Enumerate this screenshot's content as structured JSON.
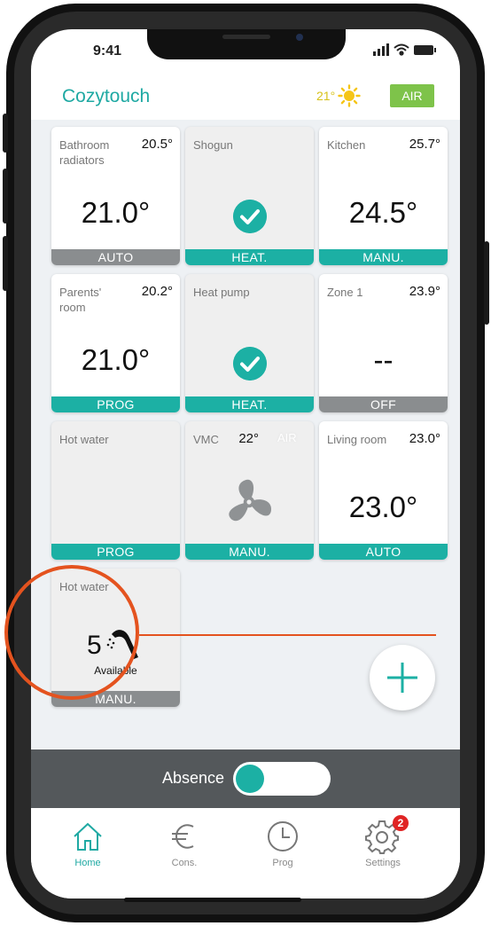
{
  "status_bar": {
    "time": "9:41"
  },
  "header": {
    "title": "Cozytouch",
    "outdoor_temp": "21°",
    "air_label": "AIR"
  },
  "tiles": [
    {
      "name": "Bathroom radiators",
      "temp": "20.5°",
      "setpoint": "21.0°",
      "mode": "AUTO"
    },
    {
      "name": "Shogun",
      "temp": "",
      "setpoint": "",
      "mode": "HEAT."
    },
    {
      "name": "Kitchen",
      "temp": "25.7°",
      "setpoint": "24.5°",
      "mode": "MANU."
    },
    {
      "name": "Parents' room",
      "temp": "20.2°",
      "setpoint": "21.0°",
      "mode": "PROG"
    },
    {
      "name": "Heat pump",
      "temp": "",
      "setpoint": "",
      "mode": "HEAT."
    },
    {
      "name": "Zone 1",
      "temp": "23.9°",
      "setpoint": "--",
      "mode": "OFF"
    },
    {
      "name": "Hot water",
      "temp": "",
      "setpoint": "",
      "mode": "PROG"
    },
    {
      "name": "VMC",
      "temp": "22°",
      "extra": "AIR",
      "setpoint": "",
      "mode": "MANU."
    },
    {
      "name": "Living room",
      "temp": "23.0°",
      "setpoint": "23.0°",
      "mode": "AUTO"
    },
    {
      "name": "Hot water",
      "temp": "",
      "showers": "5",
      "available_label": "Available",
      "mode": "MANU."
    }
  ],
  "absence": {
    "label": "Absence",
    "enabled": true
  },
  "tabs": [
    {
      "label": "Home",
      "icon": "home-icon",
      "active": true
    },
    {
      "label": "Cons.",
      "icon": "euro-icon",
      "active": false
    },
    {
      "label": "Prog",
      "icon": "clock-icon",
      "active": false
    },
    {
      "label": "Settings",
      "icon": "gear-icon",
      "active": false,
      "badge": "2"
    }
  ],
  "colors": {
    "accent": "#1cb0a4",
    "off": "#8a8d8f",
    "air": "#7ec34a",
    "highlight": "#e4531f",
    "badge": "#e02424"
  }
}
